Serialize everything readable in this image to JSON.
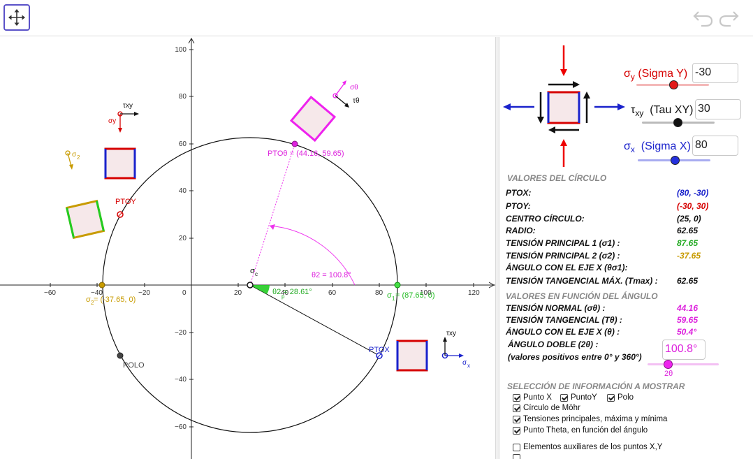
{
  "toolbar": {
    "move_tool": "move-icon",
    "undo": "undo-icon",
    "redo": "redo-icon"
  },
  "axes": {
    "x_ticks": [
      "−60",
      "−40",
      "−20",
      "0",
      "20",
      "40",
      "60",
      "80",
      "100",
      "120"
    ],
    "y_ticks": [
      "100",
      "80",
      "60",
      "40",
      "20",
      "−20",
      "−40",
      "−60"
    ]
  },
  "graph_labels": {
    "pto_theta": "PTOθ = (44.16, 59.65)",
    "sigma_theta": "σθ",
    "tau_theta": "τθ",
    "tau_xy": "τxy",
    "sigma_y": "σy",
    "sigma_2": "σ",
    "sigma_2_sub": "2",
    "ptoy": "PTOY",
    "sigma_c": "σ",
    "sigma_c_sub": "c",
    "theta2": "θ2 = 100.8°",
    "theta2_small": "θ2 = 28.61°",
    "theta2_small_sub": "p",
    "sigma1_label": "σ",
    "sigma1_sub": "1",
    "sigma1_val": " = (87.65, 0)",
    "sigma2_label": "σ",
    "sigma2_sub": "2",
    "sigma2_val": " = (-37.65, 0)",
    "ptox": "PTOX",
    "polo": "POLO",
    "tau_xy_right": "τxy",
    "sigma_x": "σ",
    "sigma_x_sub": "x"
  },
  "sliders": {
    "sigma_y": {
      "sym": "σ",
      "sub": "y",
      "label": "(Sigma Y)",
      "value": "-30",
      "color": "#d60000"
    },
    "tau_xy": {
      "sym": "τ",
      "sub": "xy",
      "label": "(Tau XY)",
      "value": "30",
      "color": "#111111"
    },
    "sigma_x": {
      "sym": "σ",
      "sub": "x",
      "label": "(Sigma X)",
      "value": "80",
      "color": "#1a22cc"
    }
  },
  "circle_values": {
    "title": "VALORES DEL CÍRCULO",
    "rows": [
      {
        "label": "PTOX:",
        "value": "(80, -30)",
        "color": "#1a22cc"
      },
      {
        "label": "PTOY:",
        "value": "(-30, 30)",
        "color": "#d60000"
      },
      {
        "label": "CENTRO CÍRCULO:",
        "value": "(25, 0)",
        "color": "#111111"
      },
      {
        "label": "RADIO:",
        "value": "62.65",
        "color": "#111111"
      },
      {
        "label": "TENSIÓN PRINCIPAL 1 (σ1) :",
        "value": "87.65",
        "color": "#22aa22"
      },
      {
        "label": "TENSIÓN PRINCIPAL 2 (σ2) :",
        "value": "-37.65",
        "color": "#c89b00"
      },
      {
        "label": "ÁNGULO CON EL EJE X (θσ1):",
        "value": "",
        "color": "#111111"
      },
      {
        "label": "TENSIÓN TANGENCIAL MÁX. (Tmax) :",
        "value": "62.65",
        "color": "#111111"
      }
    ]
  },
  "angle_values": {
    "title": "VALORES EN FUNCIÓN DEL ÁNGULO",
    "rows": [
      {
        "label": "TENSIÓN NORMAL (σθ) :",
        "value": "44.16",
        "color": "#dd22dd"
      },
      {
        "label": "TENSIÓN TANGENCIAL (Tθ) :",
        "value": "59.65",
        "color": "#dd22dd"
      },
      {
        "label": "ÁNGULO CON EL EJE X (θ) :",
        "value": "50.4°",
        "color": "#dd22dd"
      }
    ],
    "double_angle_label": "ÁNGULO DOBLE (2θ) :",
    "double_angle_note": "(valores positivos entre 0° y 360°)",
    "double_angle_value": "100.8°",
    "slider_caption": "2θ"
  },
  "display_options": {
    "title": "SELECCIÓN DE INFORMACIÓN A MOSTRAR",
    "punto_x": "Punto X",
    "punto_y": "PuntoY",
    "polo": "Polo",
    "circulo": "Círculo de Möhr",
    "tensiones": "Tensiones principales, máxima y mínima",
    "punto_theta": "Punto Theta, en función del ángulo",
    "aux_xy": "Elementos auxiliares de los puntos X,Y"
  }
}
